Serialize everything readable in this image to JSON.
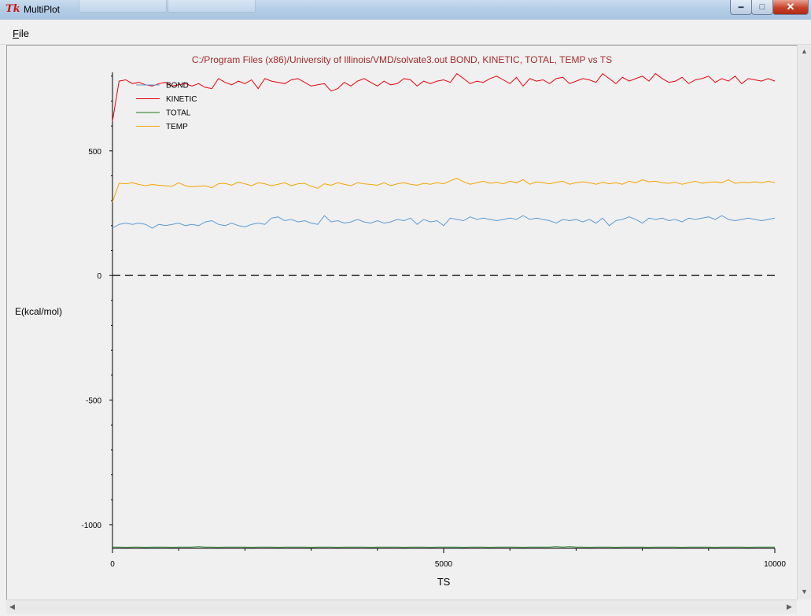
{
  "window": {
    "title": "MultiPlot",
    "logo_icon": "tk-feather-icon",
    "controls": [
      "minimize-icon",
      "maximize-icon",
      "close-icon"
    ]
  },
  "menu": {
    "file": "File"
  },
  "colors": {
    "BOND": "#5b9bd5",
    "KINETIC": "#e8000b",
    "TOTAL": "#1a7a1a",
    "TEMP": "#f5a300",
    "zero_line": "#000000",
    "title": "#a52a2a"
  },
  "chart_data": {
    "type": "line",
    "title": "C:/Program Files (x86)/University of Illinois/VMD/solvate3.out BOND, KINETIC, TOTAL, TEMP vs TS",
    "xlabel": "TS",
    "ylabel": "E(kcal/mol)",
    "xlim": [
      0,
      10000
    ],
    "ylim": [
      -1095,
      815
    ],
    "x_ticks": [
      0,
      5000,
      10000
    ],
    "y_ticks": [
      -1000,
      -500,
      0,
      500
    ],
    "legend_position": "top-left",
    "grid": false,
    "zero_line": "dashed",
    "x": [
      0,
      100,
      200,
      300,
      400,
      500,
      600,
      700,
      800,
      900,
      1000,
      1100,
      1200,
      1300,
      1400,
      1500,
      1600,
      1700,
      1800,
      1900,
      2000,
      2100,
      2200,
      2300,
      2400,
      2500,
      2600,
      2700,
      2800,
      2900,
      3000,
      3100,
      3200,
      3300,
      3400,
      3500,
      3600,
      3700,
      3800,
      3900,
      4000,
      4100,
      4200,
      4300,
      4400,
      4500,
      4600,
      4700,
      4800,
      4900,
      5000,
      5100,
      5200,
      5300,
      5400,
      5500,
      5600,
      5700,
      5800,
      5900,
      6000,
      6100,
      6200,
      6300,
      6400,
      6500,
      6600,
      6700,
      6800,
      6900,
      7000,
      7100,
      7200,
      7300,
      7400,
      7500,
      7600,
      7700,
      7800,
      7900,
      8000,
      8100,
      8200,
      8300,
      8400,
      8500,
      8600,
      8700,
      8800,
      8900,
      9000,
      9100,
      9200,
      9300,
      9400,
      9500,
      9600,
      9700,
      9800,
      9900,
      10000
    ],
    "series": [
      {
        "name": "BOND",
        "values": [
          190,
          205,
          210,
          205,
          210,
          205,
          190,
          205,
          200,
          205,
          210,
          200,
          205,
          200,
          215,
          220,
          205,
          200,
          210,
          200,
          195,
          205,
          210,
          205,
          230,
          235,
          220,
          225,
          215,
          220,
          210,
          205,
          240,
          215,
          220,
          210,
          215,
          225,
          215,
          210,
          220,
          210,
          215,
          225,
          220,
          230,
          205,
          225,
          215,
          220,
          200,
          230,
          225,
          220,
          235,
          225,
          230,
          225,
          220,
          225,
          230,
          225,
          240,
          225,
          230,
          225,
          220,
          210,
          225,
          220,
          225,
          215,
          225,
          210,
          230,
          200,
          220,
          225,
          235,
          225,
          210,
          230,
          225,
          230,
          220,
          225,
          215,
          230,
          225,
          230,
          235,
          225,
          240,
          225,
          220,
          225,
          230,
          225,
          220,
          225,
          230
        ]
      },
      {
        "name": "KINETIC",
        "values": [
          620,
          780,
          785,
          770,
          775,
          765,
          760,
          770,
          775,
          760,
          765,
          770,
          760,
          770,
          755,
          750,
          790,
          775,
          765,
          780,
          770,
          785,
          750,
          790,
          780,
          775,
          770,
          785,
          790,
          775,
          760,
          765,
          770,
          740,
          750,
          775,
          760,
          780,
          790,
          775,
          760,
          780,
          765,
          770,
          790,
          785,
          760,
          780,
          770,
          780,
          785,
          775,
          810,
          790,
          770,
          780,
          775,
          790,
          800,
          785,
          770,
          795,
          760,
          790,
          780,
          785,
          770,
          790,
          795,
          770,
          780,
          790,
          785,
          775,
          810,
          790,
          770,
          795,
          780,
          790,
          800,
          780,
          810,
          790,
          775,
          780,
          795,
          770,
          785,
          790,
          800,
          775,
          790,
          780,
          800,
          770,
          790,
          785,
          780,
          790,
          780
        ]
      },
      {
        "name": "TOTAL",
        "values": [
          -1090,
          -1090,
          -1091,
          -1090,
          -1090,
          -1091,
          -1090,
          -1090,
          -1090,
          -1091,
          -1090,
          -1090,
          -1090,
          -1088,
          -1090,
          -1090,
          -1091,
          -1090,
          -1090,
          -1090,
          -1090,
          -1091,
          -1090,
          -1090,
          -1090,
          -1091,
          -1090,
          -1090,
          -1090,
          -1090,
          -1091,
          -1090,
          -1090,
          -1090,
          -1091,
          -1090,
          -1090,
          -1090,
          -1090,
          -1091,
          -1090,
          -1090,
          -1090,
          -1090,
          -1091,
          -1090,
          -1090,
          -1090,
          -1091,
          -1090,
          -1090,
          -1090,
          -1090,
          -1091,
          -1090,
          -1090,
          -1090,
          -1091,
          -1090,
          -1090,
          -1090,
          -1090,
          -1091,
          -1090,
          -1090,
          -1090,
          -1090,
          -1088,
          -1090,
          -1088,
          -1090,
          -1090,
          -1091,
          -1090,
          -1090,
          -1090,
          -1091,
          -1090,
          -1090,
          -1090,
          -1090,
          -1091,
          -1090,
          -1090,
          -1090,
          -1090,
          -1091,
          -1090,
          -1090,
          -1090,
          -1090,
          -1091,
          -1090,
          -1090,
          -1090,
          -1090,
          -1091,
          -1090,
          -1090,
          -1090,
          -1090
        ]
      },
      {
        "name": "TEMP",
        "values": [
          295,
          370,
          368,
          372,
          365,
          360,
          365,
          362,
          360,
          358,
          372,
          360,
          356,
          358,
          360,
          352,
          368,
          370,
          362,
          375,
          368,
          360,
          372,
          368,
          360,
          366,
          372,
          360,
          368,
          370,
          358,
          350,
          368,
          362,
          372,
          366,
          360,
          372,
          368,
          365,
          362,
          372,
          360,
          368,
          372,
          366,
          362,
          370,
          366,
          372,
          368,
          380,
          390,
          376,
          366,
          372,
          378,
          370,
          374,
          368,
          378,
          372,
          384,
          366,
          376,
          372,
          368,
          374,
          378,
          366,
          372,
          376,
          372,
          366,
          374,
          368,
          372,
          366,
          378,
          372,
          384,
          376,
          378,
          372,
          370,
          374,
          366,
          372,
          378,
          370,
          374,
          376,
          372,
          384,
          370,
          374,
          372,
          376,
          372,
          378,
          372
        ]
      }
    ]
  }
}
